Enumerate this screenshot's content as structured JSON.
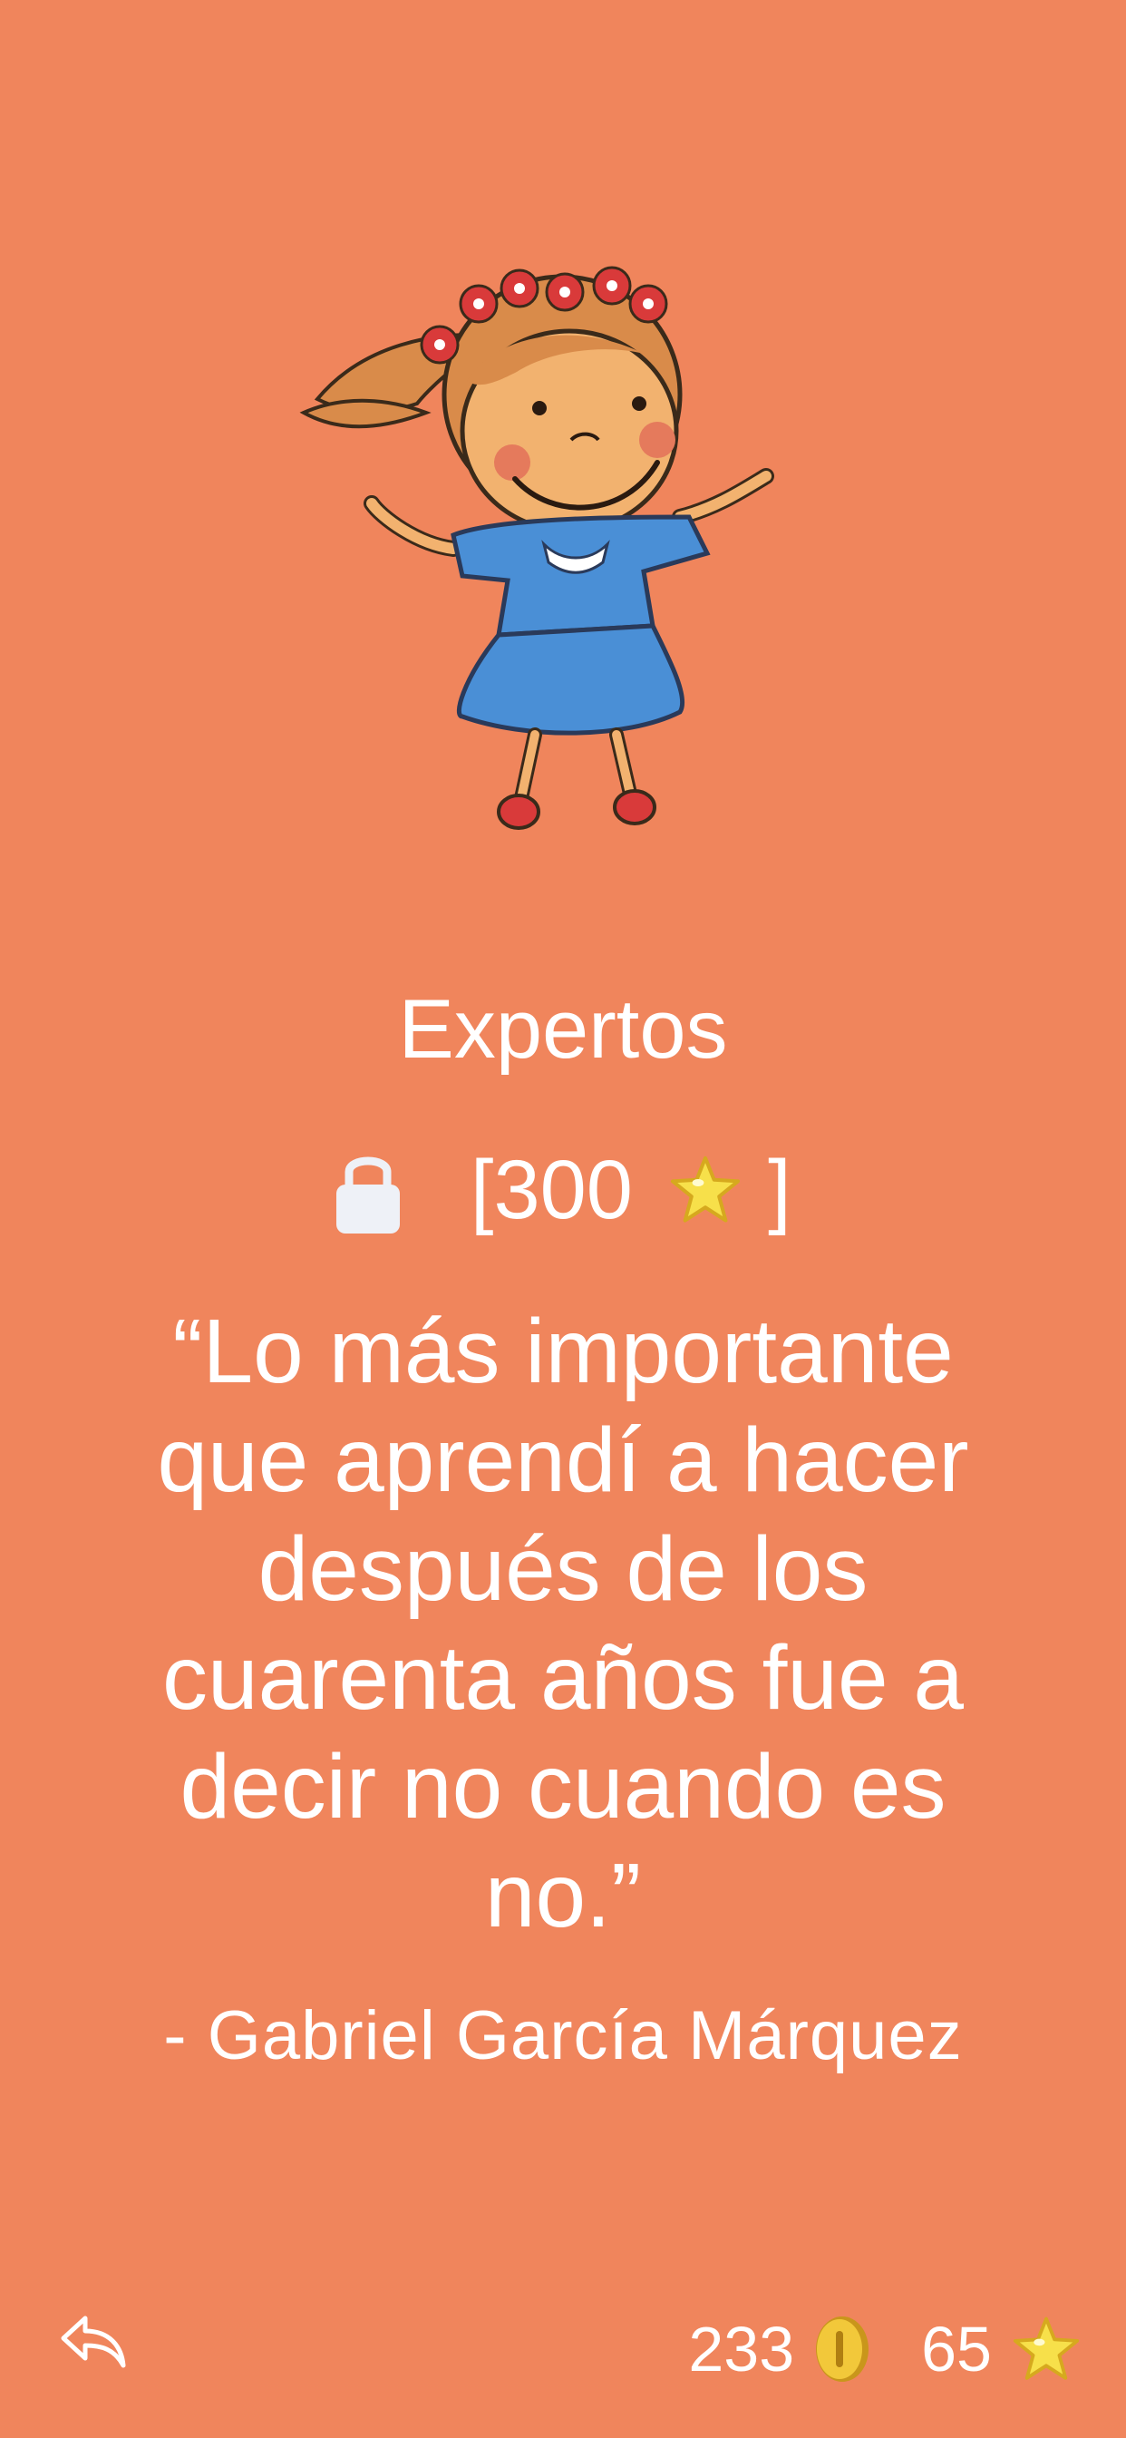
{
  "level": {
    "title": "Expertos",
    "cost_prefix": "[300",
    "cost_suffix": "]",
    "lock_icon": "lock-icon",
    "star_icon": "star-icon"
  },
  "quote": {
    "text": "“Lo más importante que aprendí a hacer después de los cuarenta años fue a decir no cuando es no.”",
    "author": "- Gabriel García Márquez"
  },
  "footer": {
    "back_icon": "reply-arrow-icon",
    "coins": "233",
    "coin_icon": "coin-icon",
    "stars": "65",
    "star_icon": "star-icon"
  },
  "colors": {
    "background": "#F0855C",
    "text": "#FFFFFF",
    "star": "#F7E04A",
    "coin": "#E9B82A"
  }
}
